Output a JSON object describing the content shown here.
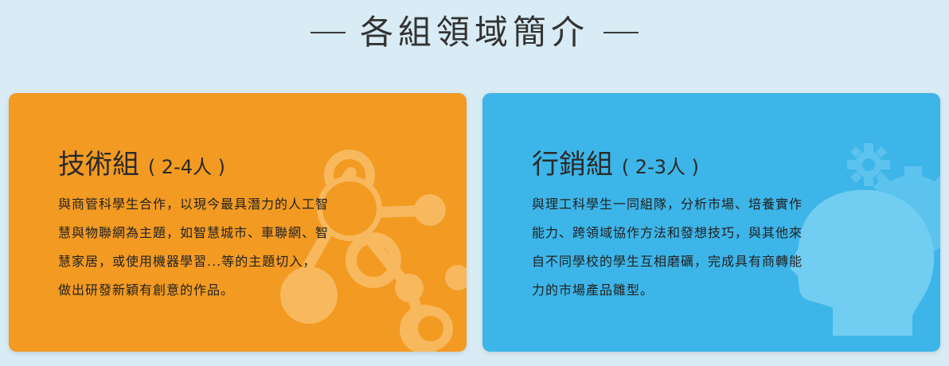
{
  "section": {
    "title": "各組領域簡介"
  },
  "cards": [
    {
      "title": "技術組",
      "subtitle": "( 2-4人 )",
      "description": "與商管科學生合作，以現今最具潛力的人工智慧與物聯網為主題，如智慧城市、車聯網、智慧家居，或使用機器學習...等的主題切入，做出研發新穎有創意的作品。",
      "color": "#f39a22",
      "icon": "molecule-network-icon"
    },
    {
      "title": "行銷組",
      "subtitle": "( 2-3人 )",
      "description": "與理工科學生一同組隊，分析市場、培養實作能力、跨領域協作方法和發想技巧，與其他來自不同學校的學生互相磨礪，完成具有商轉能力的市場產品雛型。",
      "color": "#3db5e8",
      "icon": "head-gears-icon"
    }
  ]
}
